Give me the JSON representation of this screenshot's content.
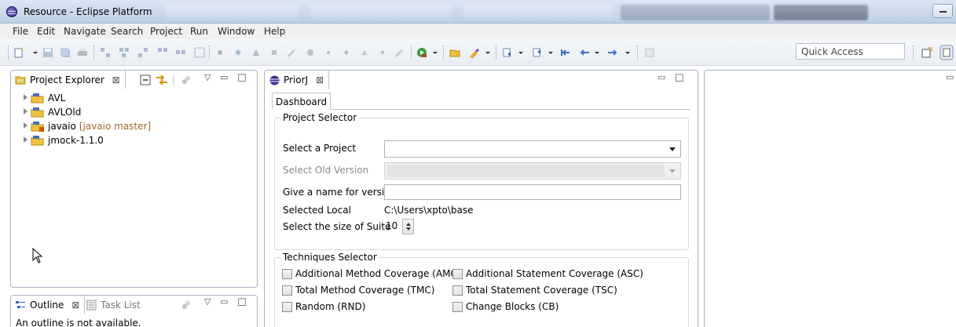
{
  "window": {
    "title": "Resource - Eclipse Platform"
  },
  "menu": [
    "File",
    "Edit",
    "Navigate",
    "Search",
    "Project",
    "Run",
    "Window",
    "Help"
  ],
  "toolbar": {
    "quick_access": "Quick Access"
  },
  "project_explorer": {
    "tab_label": "Project Explorer",
    "close_glyph": "⊠",
    "projects": [
      {
        "name": "AVL",
        "git": ""
      },
      {
        "name": "AVLOld",
        "git": ""
      },
      {
        "name": "javaio",
        "git": "[javaio master]"
      },
      {
        "name": "jmock-1.1.0",
        "git": ""
      }
    ]
  },
  "outline": {
    "tab_label": "Outline",
    "close_glyph": "⊠",
    "task_list_label": "Task List",
    "message": "An outline is not available."
  },
  "priorj": {
    "tab_label": "PriorJ",
    "close_glyph": "⊠",
    "dashboard_tab": "Dashboard",
    "project_selector": {
      "title": "Project Selector",
      "select_project_label": "Select a Project",
      "select_project_value": "",
      "select_old_version_label": "Select Old Version",
      "version_name_label": "Give a name for version",
      "version_name_value": "",
      "selected_local_label": "Selected Local",
      "selected_local_value": "C:\\Users\\xpto\\base",
      "suite_size_label": "Select the size of Suite",
      "suite_size_value": "10"
    },
    "techniques_selector": {
      "title": "Techniques Selector",
      "techniques": [
        {
          "label": "Additional Method Coverage (AMC)",
          "checked": false
        },
        {
          "label": "Additional Statement Coverage (ASC)",
          "checked": false
        },
        {
          "label": "Total Method Coverage (TMC)",
          "checked": false
        },
        {
          "label": "Total Statement Coverage (TSC)",
          "checked": false
        },
        {
          "label": "Random (RND)",
          "checked": false
        },
        {
          "label": "Change Blocks (CB)",
          "checked": false
        }
      ]
    }
  },
  "colors": {
    "titlebar": "#c9d8ea",
    "menubar": "#f0f0f0",
    "panel_border": "#a7b3c3",
    "git_label": "#a56a2a"
  }
}
